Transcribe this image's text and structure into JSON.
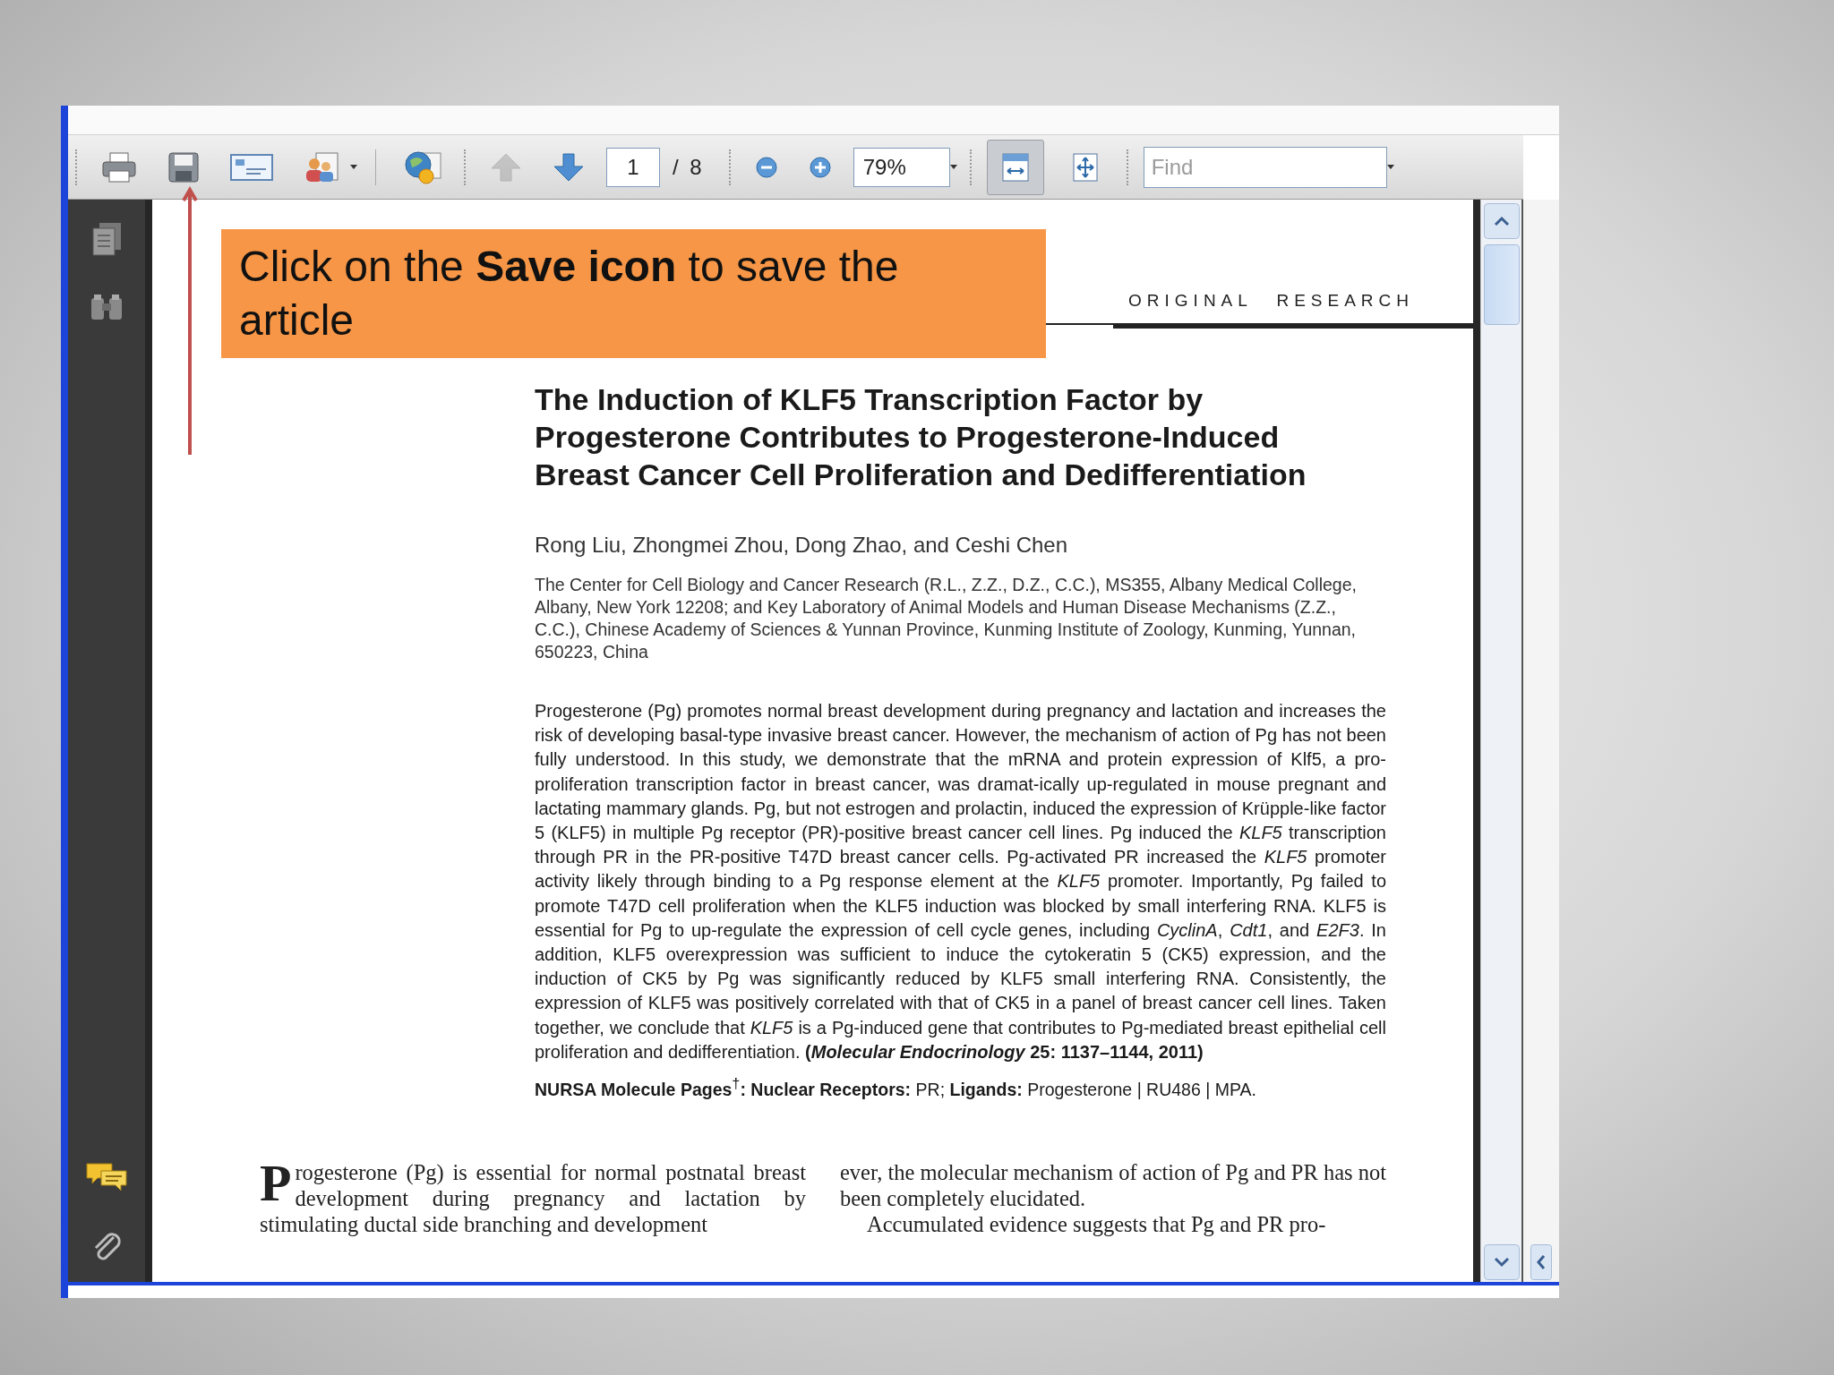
{
  "toolbar": {
    "page_field": "1",
    "page_count": "/ 8",
    "zoom_field": "79%",
    "find": {
      "placeholder": "Find"
    },
    "previous_page_disabled": true,
    "view_buttons": [
      {
        "kind": "fit-width",
        "selected": true
      },
      {
        "kind": "fit-page",
        "selected": false
      }
    ]
  },
  "callout": {
    "text": "Click on the **Save icon** to save the article"
  },
  "document": {
    "section_label": "ORIGINAL RESEARCH",
    "title_lines": [
      "The Induction of KLF5 Transcription Factor by",
      "Progesterone Contributes to Progesterone-Induced",
      "Breast Cancer Cell Proliferation and Dedifferentiation"
    ],
    "authors": "Rong Liu, Zhongmei Zhou, Dong Zhao, and Ceshi Chen",
    "affiliation": "The Center for Cell Biology and Cancer Research (R.L., Z.Z., D.Z., C.C.), MS355, Albany Medical College, Albany, New York 12208; and Key Laboratory of Animal Models and Human Disease Mechanisms (Z.Z., C.C.), Chinese Academy of Sciences & Yunnan Province, Kunming Institute of Zoology, Kunming, Yunnan, 650223, China",
    "abstract": "Progesterone (Pg) promotes normal breast development during pregnancy and lactation and increases the risk of developing basal-type invasive breast cancer. However, the mechanism of action of Pg has not been fully understood. In this study, we demonstrate that the mRNA and protein expression of Klf5, a pro-proliferation transcription factor in breast cancer, was dramat-ically up-regulated in mouse pregnant and lactating mammary glands. Pg, but not estrogen and prolactin, induced the expression of Krüpple-like factor 5 (KLF5) in multiple Pg receptor (PR)-positive breast cancer cell lines. Pg induced the *KLF5* transcription through PR in the PR-positive T47D breast cancer cells. Pg-activated PR increased the *KLF5* promoter activity likely through binding to a Pg response element at the *KLF5* promoter. Importantly, Pg failed to promote T47D cell proliferation when the KLF5 induction was blocked by small interfering RNA. KLF5 is essential for Pg to up-regulate the expression of cell cycle genes, including *CyclinA*, *Cdt1*, and *E2F3*. In addition, KLF5 overexpression was sufficient to induce the cytokeratin 5 (CK5) expression, and the induction of CK5 by Pg was significantly reduced by KLF5 small interfering RNA. Consistently, the expression of KLF5 was positively correlated with that of CK5 in a panel of breast cancer cell lines. Taken together, we conclude that *KLF5* is a Pg-induced gene that contributes to Pg-mediated breast epithelial cell proliferation and dedifferentiation. **(*Molecular Endocrinology* 25: 1137–1144, 2011)**",
    "keywords": "**NURSA Molecule Pages**$^{†}$**: Nuclear Receptors:** PR; **Ligands:** Progesterone | RU486 | MPA.",
    "body_left": {
      "drop_cap": "P",
      "text": "rogesterone (Pg) is essential for normal postnatal breast development during pregnancy and lactation by stimulating ductal side branching and development"
    },
    "body_right": [
      "ever, the molecular mechanism of action of Pg and PR has not been completely elucidated.",
      "Accumulated evidence suggests that Pg and PR pro-"
    ]
  }
}
